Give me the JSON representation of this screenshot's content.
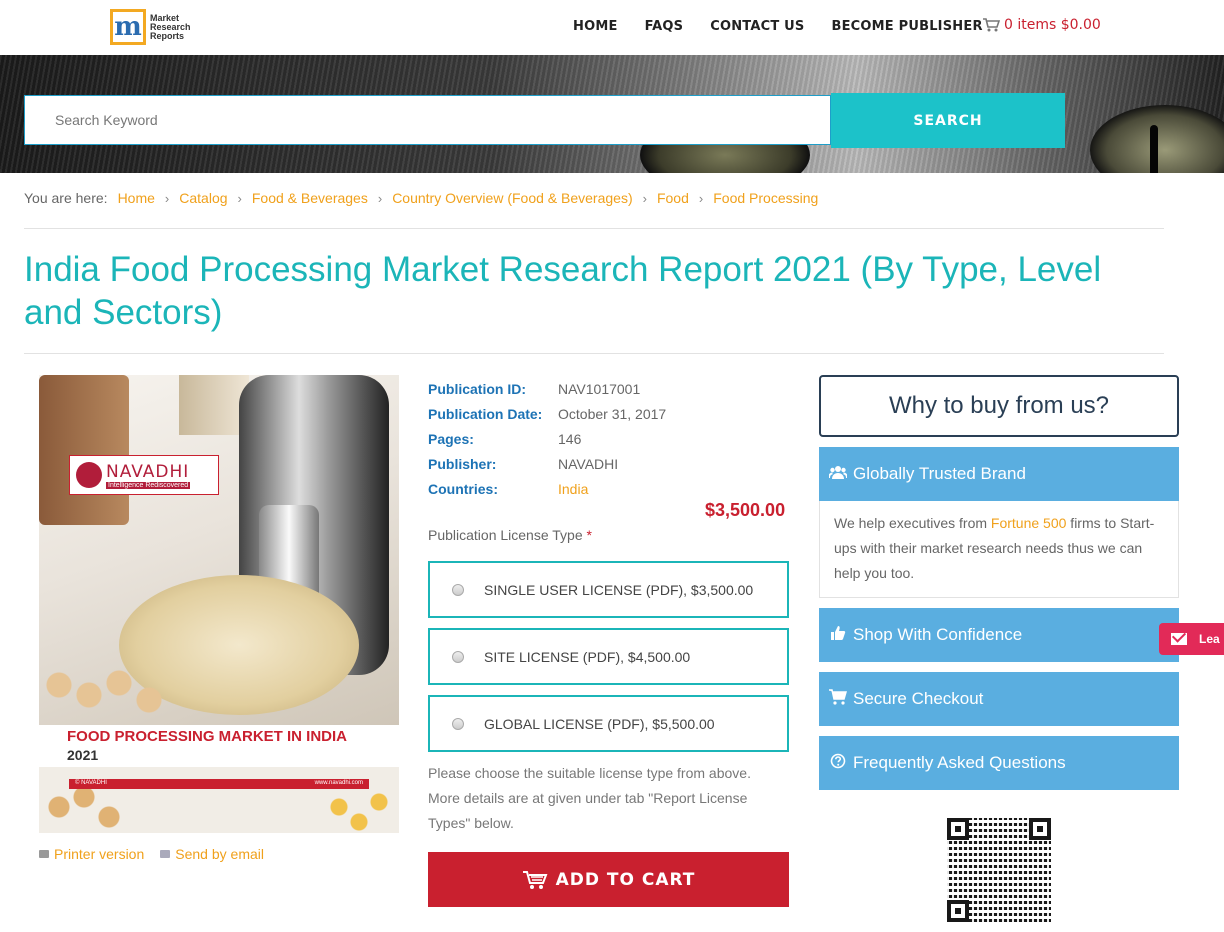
{
  "header": {
    "logo_text": "Market Research Reports",
    "nav": [
      "HOME",
      "FAQS",
      "CONTACT US",
      "BECOME PUBLISHER"
    ],
    "cart": "0 items $0.00"
  },
  "hero": {
    "search_placeholder": "Search Keyword",
    "search_button": "SEARCH"
  },
  "breadcrumb": {
    "label": "You are here:",
    "items": [
      "Home",
      "Catalog",
      "Food & Beverages",
      "Country Overview (Food & Beverages)",
      "Food",
      "Food Processing"
    ]
  },
  "page_title": "India Food Processing Market Research Report 2021 (By Type, Level and Sectors)",
  "cover": {
    "brand": "NAVADHI",
    "brand_tagline": "Intelligence Rediscovered",
    "heading": "FOOD PROCESSING MARKET IN INDIA",
    "year": "2021",
    "strip_left": "© NAVADHI",
    "strip_right": "www.navadhi.com"
  },
  "cover_links": {
    "printer": "Printer version",
    "email": "Send by email"
  },
  "details": {
    "rows": [
      {
        "k": "Publication ID:",
        "v": "NAV1017001"
      },
      {
        "k": "Publication Date:",
        "v": "October 31, 2017"
      },
      {
        "k": "Pages:",
        "v": "146"
      },
      {
        "k": "Publisher:",
        "v": "NAVADHI"
      },
      {
        "k": "Countries:",
        "v": "India"
      }
    ],
    "price": "$3,500.00",
    "license_label": "Publication License Type",
    "required_mark": "*",
    "licenses": [
      "SINGLE USER LICENSE (PDF), $3,500.00",
      "SITE LICENSE (PDF), $4,500.00",
      "GLOBAL LICENSE (PDF), $5,500.00"
    ],
    "note": "Please choose the suitable license type from above. More details are at given under tab \"Report License Types\" below.",
    "add_to_cart": "ADD TO CART"
  },
  "sidebar": {
    "why": "Why to buy from us?",
    "brand_title": "Globally Trusted Brand",
    "brand_desc_pre": "We help executives from ",
    "brand_desc_hl": "Fortune 500",
    "brand_desc_post": " firms to Start-ups with their market research needs thus we can help you too.",
    "shop": "Shop With Confidence",
    "checkout": "Secure Checkout",
    "faq": "Frequently Asked Questions"
  },
  "lead_tab": "Lea",
  "colors": {
    "accent_teal": "#1bb5b8",
    "link_orange": "#f0a11c",
    "brand_red": "#c9202f",
    "sidebar_blue": "#5aaee0"
  }
}
